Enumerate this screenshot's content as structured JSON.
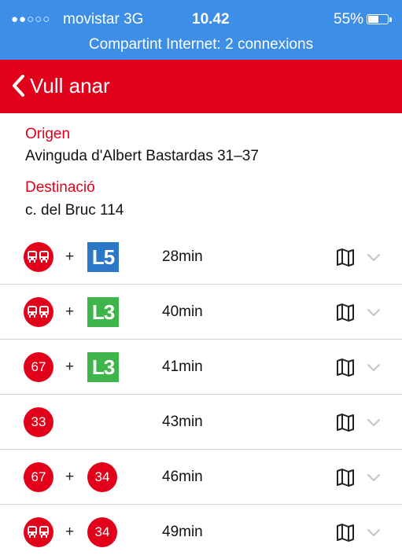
{
  "status_bar": {
    "signal": "●●○○○",
    "carrier": "movistar  3G",
    "time": "10.42",
    "battery_percent": "55%",
    "battery_level": 0.55,
    "hotspot": "Compartint Internet: 2 connexions"
  },
  "nav": {
    "title": "Vull anar",
    "back_icon": "chevron-left-icon"
  },
  "trip": {
    "origin_label": "Origen",
    "origin_value": "Avinguda d'Albert Bastardas 31–37",
    "destination_label": "Destinació",
    "destination_value": "c. del Bruc 114"
  },
  "colors": {
    "status_bar": "#3d8ee6",
    "nav_bar": "#e3001b",
    "bus": "#e3001b",
    "metro_L5": "#2d77c7",
    "metro_L3": "#3db54a"
  },
  "routes": [
    {
      "first": {
        "kind": "bus-icon",
        "label": ""
      },
      "plus": "+",
      "second": {
        "kind": "metro",
        "label": "L5",
        "color": "#2d77c7"
      },
      "duration": "28min"
    },
    {
      "first": {
        "kind": "bus-icon",
        "label": ""
      },
      "plus": "+",
      "second": {
        "kind": "metro",
        "label": "L3",
        "color": "#3db54a"
      },
      "duration": "40min"
    },
    {
      "first": {
        "kind": "bus",
        "label": "67"
      },
      "plus": "+",
      "second": {
        "kind": "metro",
        "label": "L3",
        "color": "#3db54a"
      },
      "duration": "41min"
    },
    {
      "first": {
        "kind": "bus",
        "label": "33"
      },
      "plus": "",
      "second": null,
      "duration": "43min"
    },
    {
      "first": {
        "kind": "bus",
        "label": "67"
      },
      "plus": "+",
      "second": {
        "kind": "bus",
        "label": "34"
      },
      "duration": "46min"
    },
    {
      "first": {
        "kind": "bus-icon",
        "label": ""
      },
      "plus": "+",
      "second": {
        "kind": "bus",
        "label": "34"
      },
      "duration": "49min"
    }
  ],
  "row_icons": {
    "map": "map-icon",
    "expand": "chevron-down-icon"
  }
}
